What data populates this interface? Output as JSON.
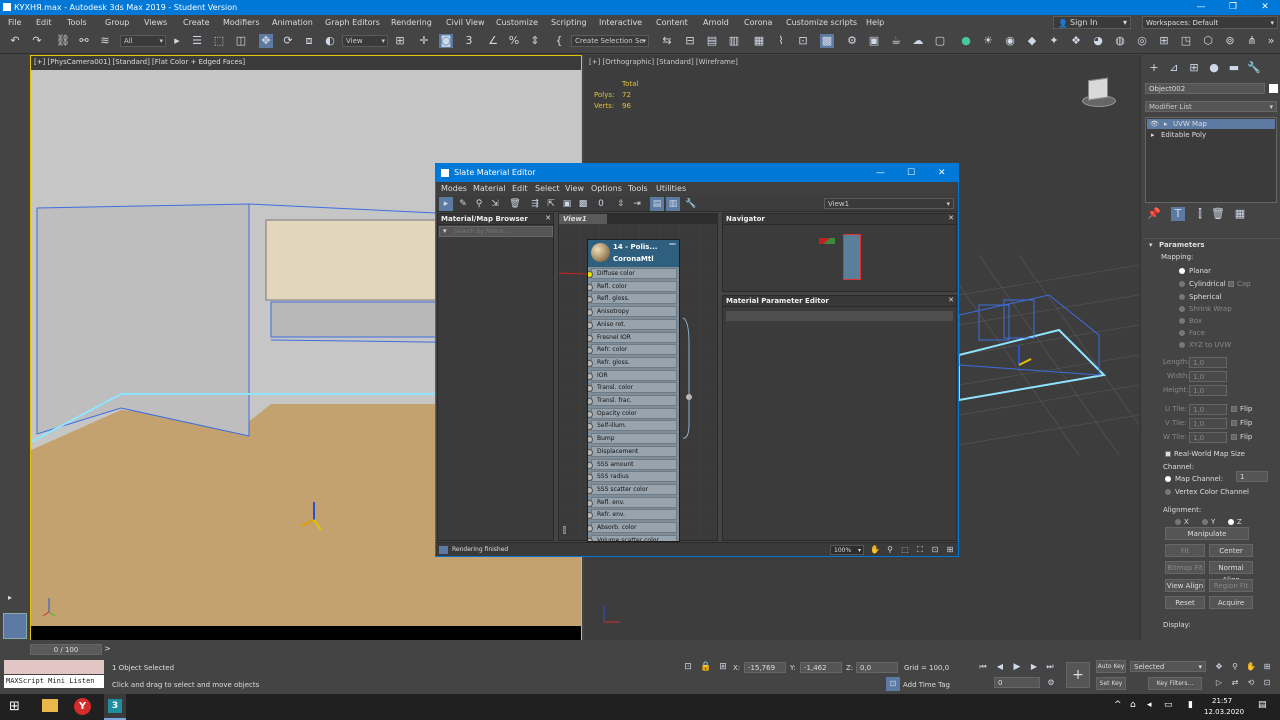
{
  "window": {
    "title": "КУХНЯ.max - Autodesk 3ds Max 2019 - Student Version",
    "min": "—",
    "max": "❐",
    "close": "✕"
  },
  "menu": [
    "File",
    "Edit",
    "Tools",
    "Group",
    "Views",
    "Create",
    "Modifiers",
    "Animation",
    "Graph Editors",
    "Rendering",
    "Civil View",
    "Customize",
    "Scripting",
    "Interactive",
    "Content",
    "Arnold",
    "Corona",
    "Customize scripts",
    "Help"
  ],
  "signin": "Sign In",
  "workspaces": "Workspaces:  Default",
  "toolbar": {
    "filter": "All",
    "view": "View",
    "selection_set": "Create Selection Se"
  },
  "viewport1": {
    "label": "[+] [PhysCamera001] [Standard] [Flat Color + Edged Faces]"
  },
  "viewport2": {
    "label": "[+] [Orthographic] [Standard] [Wireframe]",
    "stats_total": "Total",
    "polys_label": "Polys:",
    "polys": "72",
    "verts_label": "Verts:",
    "verts": "96"
  },
  "cmd": {
    "object_name": "Object002",
    "modifier_list": "Modifier List",
    "stack": [
      "UVW Map",
      "Editable Poly"
    ],
    "parameters": "Parameters",
    "mapping": "Mapping:",
    "mapping_opts": [
      "Planar",
      "Cylindrical",
      "Cap",
      "Spherical",
      "Shrink Wrap",
      "Box",
      "Face",
      "XYZ to UVW"
    ],
    "length": "Length:",
    "width": "Width:",
    "height": "Height:",
    "val": "1,0",
    "utile": "U Tile:",
    "vtile": "V Tile:",
    "wtile": "W Tile:",
    "flip": "Flip",
    "realworld": "Real-World Map Size",
    "channel": "Channel:",
    "map_channel": "Map Channel:",
    "map_channel_val": "1",
    "vertex_color": "Vertex Color Channel",
    "alignment": "Alignment:",
    "x": "X",
    "y": "Y",
    "z": "Z",
    "manipulate": "Manipulate",
    "fit": "Fit",
    "center": "Center",
    "bitmap_fit": "Bitmap Fit",
    "normal_align": "Normal Align",
    "view_align": "View Align",
    "region_fit": "Region Fit",
    "reset": "Reset",
    "acquire": "Acquire",
    "display": "Display:"
  },
  "sme": {
    "title": "Slate Material Editor",
    "menu": [
      "Modes",
      "Material",
      "Edit",
      "Select",
      "View",
      "Options",
      "Tools",
      "Utilities"
    ],
    "view_dropdown": "View1",
    "browser_title": "Material/Map Browser",
    "search_placeholder": "Search by Name ...",
    "view_tab": "View1",
    "navigator": "Navigator",
    "param_editor": "Material Parameter Editor",
    "node_title": "14 - Polis...",
    "node_type": "CoronaMtl",
    "slots": [
      "Diffuse color",
      "Refl. color",
      "Refl. gloss.",
      "Anisotropy",
      "Aniso rot.",
      "Fresnel IOR",
      "Refr. color",
      "Refr. gloss.",
      "IOR",
      "Transl. color",
      "Transl. frac.",
      "Opacity color",
      "Self-illum.",
      "Bump",
      "Displacement",
      "SSS amount",
      "SSS radius",
      "SSS scatter color",
      "Refl. env.",
      "Refr. env.",
      "Absorb. color",
      "Volume scatter color"
    ],
    "status": "Rendering finished",
    "zoom": "100%"
  },
  "time": {
    "frame": "0 / 100"
  },
  "status": {
    "selected": "1 Object Selected",
    "hint": "Click and drag to select and move objects",
    "maxscript": "MAXScript Mini Listen",
    "x_label": "X:",
    "x": "-15,769",
    "y_label": "Y:",
    "y": "-1,462",
    "z_label": "Z:",
    "z": "0,0",
    "grid": "Grid = 100,0",
    "add_time_tag": "Add Time Tag",
    "autokey": "Auto Key",
    "setkey": "Set Key",
    "selected_dd": "Selected",
    "key_filters": "Key Filters...",
    "frame_val": "0"
  },
  "taskbar": {
    "time": "21:57",
    "date": "12.03.2020"
  }
}
